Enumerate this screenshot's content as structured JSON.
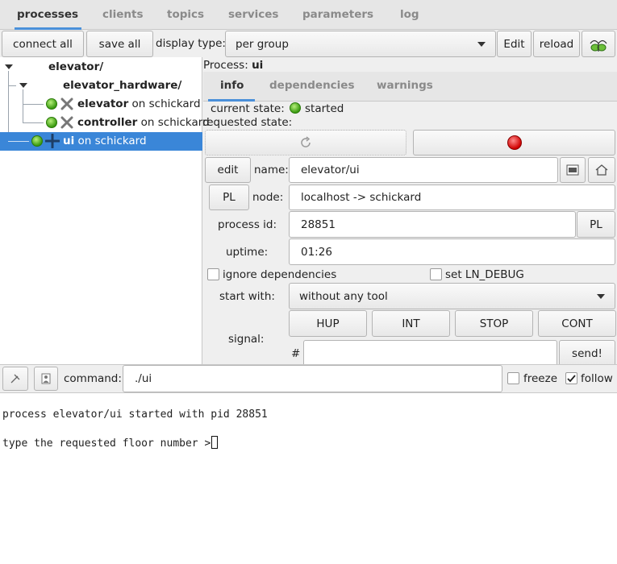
{
  "tabs": [
    {
      "label": "processes"
    },
    {
      "label": "clients"
    },
    {
      "label": "topics"
    },
    {
      "label": "services"
    },
    {
      "label": "parameters"
    },
    {
      "label": "log"
    }
  ],
  "toolbar": {
    "connect_all": "connect all",
    "save_all": "save all",
    "display_type_label": "display type:",
    "display_type_value": "per group",
    "edit": "Edit",
    "reload": "reload"
  },
  "tree": {
    "root": "elevator/",
    "group": "elevator_hardware/",
    "items": [
      {
        "name": "elevator",
        "suffix": " on schickard"
      },
      {
        "name": "controller",
        "suffix": " on schickard"
      },
      {
        "name": "ui",
        "suffix": " on schickard"
      }
    ]
  },
  "process": {
    "header_label": "Process: ",
    "header_name": "ui",
    "subtabs": [
      {
        "label": "info"
      },
      {
        "label": "dependencies"
      },
      {
        "label": "warnings"
      }
    ],
    "current_state_label": "current state:",
    "current_state": "started",
    "requested_state_label": "requested state:",
    "edit_button": "edit",
    "name_label": "name:",
    "name_value": "elevator/ui",
    "pl_button": "PL",
    "node_label": "node:",
    "node_value": "localhost -> schickard",
    "pid_label": "process id:",
    "pid_value": "28851",
    "pid_pl_button": "PL",
    "uptime_label": "uptime:",
    "uptime_value": "01:26",
    "ignore_deps": "ignore dependencies",
    "set_debug": "set LN_DEBUG",
    "start_with_label": "start with:",
    "start_with_value": "without any tool",
    "signal_label": "signal:",
    "signals": [
      "HUP",
      "INT",
      "STOP",
      "CONT"
    ],
    "hash_label": "#",
    "send_button": "send!"
  },
  "command_bar": {
    "command_label": "command:",
    "command_value": "./ui",
    "freeze": "freeze",
    "follow": "follow"
  },
  "terminal": {
    "lines": [
      "process elevator/ui started with pid 28851",
      "type the requested floor number >"
    ]
  },
  "colors": {
    "selection": "#3a86d8",
    "tab_accent": "#4a90d9",
    "status_green": "#3a9a10",
    "stop_red": "#d00000"
  }
}
